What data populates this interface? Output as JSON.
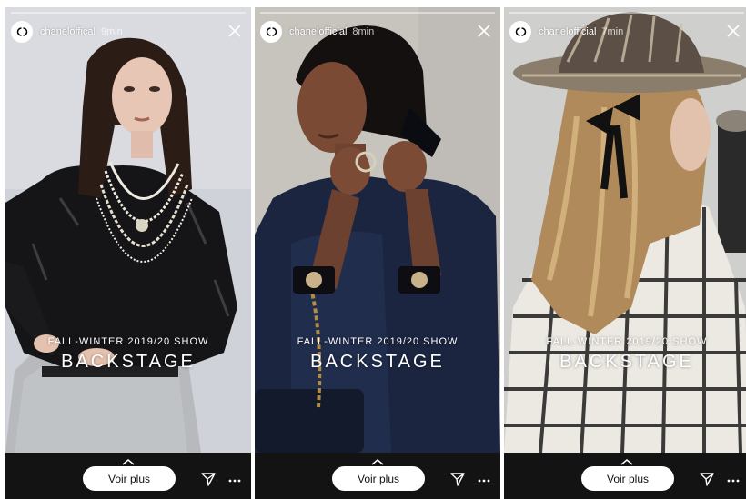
{
  "stories": [
    {
      "username": "chaneloffical",
      "time": "9min",
      "caption_sub": "FALL-WINTER 2019/20 SHOW",
      "caption_main": "BACKSTAGE",
      "cta_label": "Voir plus"
    },
    {
      "username": "chanelofficial",
      "time": "8min",
      "caption_sub": "FALL-WINTER 2019/20 SHOW",
      "caption_main": "BACKSTAGE",
      "cta_label": "Voir plus"
    },
    {
      "username": "chanelofficial",
      "time": "7min",
      "caption_sub": "FALL-WINTER 2019/20 SHOW",
      "caption_main": "BACKSTAGE",
      "cta_label": "Voir plus"
    }
  ],
  "icons": {
    "logo": "chanel-logo-icon",
    "close": "close-icon",
    "swipe_up": "chevron-up-icon",
    "send": "send-icon",
    "more": "more-icon"
  },
  "colors": {
    "bottom_bar": "#131313",
    "button": "#ffffff",
    "text": "#ffffff"
  }
}
